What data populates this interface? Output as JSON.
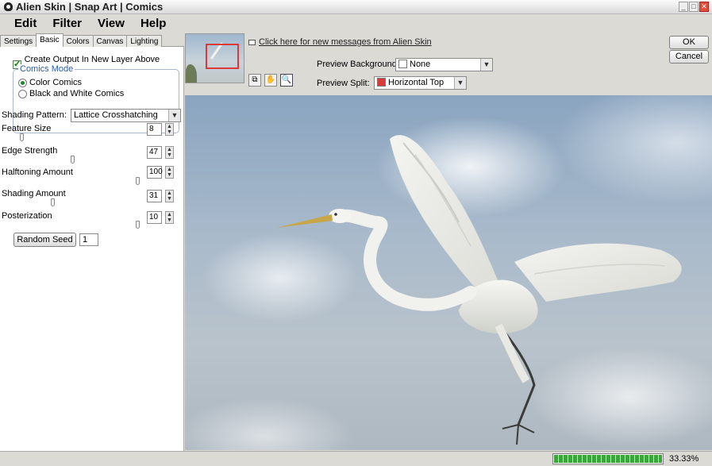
{
  "window": {
    "title": "Alien Skin | Snap Art | Comics",
    "minimize_glyph": "_",
    "maximize_glyph": "□",
    "close_glyph": "✕"
  },
  "menu": [
    "Edit",
    "Filter",
    "View",
    "Help"
  ],
  "tabs": [
    "Settings",
    "Basic",
    "Colors",
    "Canvas",
    "Lighting"
  ],
  "active_tab": "Basic",
  "settings": {
    "create_output_label": "Create Output In New Layer Above Current",
    "create_output_checked": true,
    "comics_mode": {
      "legend": "Comics Mode",
      "options": [
        "Color Comics",
        "Black and White Comics"
      ],
      "selected": "Color Comics"
    },
    "shading_pattern": {
      "label": "Shading Pattern:",
      "value": "Lattice Crosshatching"
    },
    "sliders": [
      {
        "label": "Feature Size",
        "value": "8",
        "fraction": 0.06
      },
      {
        "label": "Edge Strength",
        "value": "47",
        "fraction": 0.47
      },
      {
        "label": "Halftoning Amount",
        "value": "100",
        "fraction": 1.0
      },
      {
        "label": "Shading Amount",
        "value": "31",
        "fraction": 0.31
      },
      {
        "label": "Posterization",
        "value": "10",
        "fraction": 1.0
      }
    ],
    "random_seed": {
      "button_label": "Random Seed",
      "value": "1"
    }
  },
  "toolbar": {
    "message_link": "Click here for new messages from Alien Skin",
    "preview_background": {
      "label": "Preview Background:",
      "value": "None",
      "swatch": "#ffffff"
    },
    "preview_split": {
      "label": "Preview Split:",
      "value": "Horizontal Top",
      "swatch": "#d93b3b"
    },
    "tools": [
      "compare-icon",
      "hand-icon",
      "zoom-icon"
    ],
    "tool_glyphs": {
      "compare": "⧉",
      "hand": "✋",
      "zoom": "🔍"
    },
    "ok_label": "OK",
    "cancel_label": "Cancel"
  },
  "status": {
    "progress_fraction": 1.0,
    "zoom": "33.33%"
  },
  "colors": {
    "progress": "#3aa63a",
    "group_legend": "#2a5ea8",
    "selection_rect": "#d93b3b"
  }
}
